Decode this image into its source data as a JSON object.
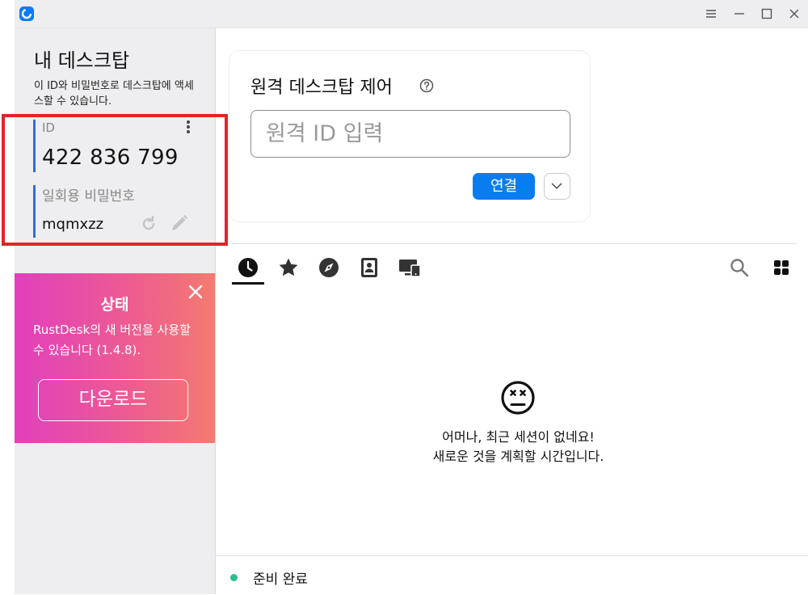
{
  "window": {
    "menu_icon": "hamburger-icon",
    "minimize_icon": "minimize-icon",
    "maximize_icon": "maximize-icon",
    "close_icon": "close-icon"
  },
  "sidebar": {
    "title": "내 데스크탑",
    "description": "이 ID와 비밀번호로 데스크탑에 액세스할 수 있습니다.",
    "id_label": "ID",
    "id_value": "422 836 799",
    "password_label": "일회용 비밀번호",
    "password_value": "mqmxzz"
  },
  "promo": {
    "title": "상태",
    "text": "RustDesk의 새 버전을 사용할 수 있습니다 (1.4.8).",
    "button_label": "다운로드",
    "colors": {
      "start": "#e13fbd",
      "end": "#f47b6f"
    }
  },
  "connect": {
    "title": "원격 데스크탑 제어",
    "input_value": "",
    "input_placeholder": "원격 ID 입력",
    "connect_label": "연결"
  },
  "tabs": [
    {
      "icon": "recent-clock-icon",
      "active": true
    },
    {
      "icon": "favorites-star-icon"
    },
    {
      "icon": "discovered-compass-icon"
    },
    {
      "icon": "address-book-icon"
    },
    {
      "icon": "device-group-icon"
    }
  ],
  "empty_state": {
    "icon": "sad-face-icon",
    "line1": "어머나, 최근 세션이 없네요!",
    "line2": "새로운 것을 계획할 시간입니다."
  },
  "status": {
    "text": "준비 완료",
    "dot_color": "#2ebd91"
  },
  "colors": {
    "accent": "#0a7cf2",
    "id_bar": "#2e6fd8",
    "highlight_box": "#e1242b"
  }
}
